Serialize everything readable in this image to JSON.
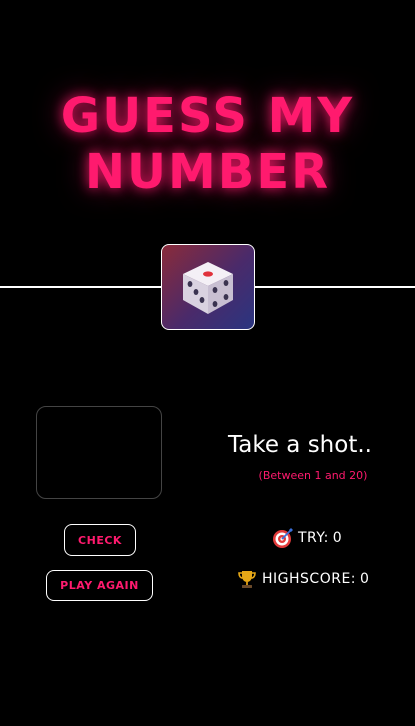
{
  "title": {
    "line1": "GUESS MY",
    "line2": "NUMBER"
  },
  "dice": {
    "icon": "dice-icon"
  },
  "input": {
    "value": "",
    "placeholder": ""
  },
  "buttons": {
    "check_label": "CHECK",
    "play_again_label": "PLAY AGAIN"
  },
  "message": {
    "text": "Take a shot..",
    "range": "(Between 1 and 20)"
  },
  "stats": {
    "try_label": "TRY:",
    "try_value": "0",
    "try_icon": "target-icon",
    "highscore_label": "HIGHSCORE:",
    "highscore_value": "0",
    "highscore_icon": "trophy-icon"
  },
  "colors": {
    "accent": "#ff1a6e",
    "background": "#000000",
    "text": "#ffffff"
  }
}
